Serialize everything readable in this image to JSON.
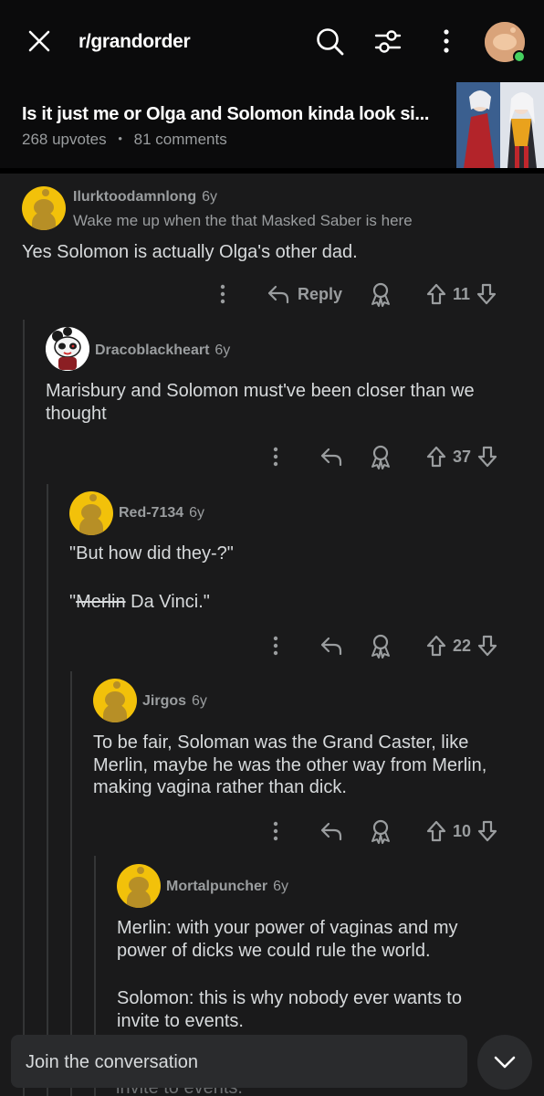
{
  "header": {
    "subreddit": "r/grandorder",
    "icons": [
      "close-icon",
      "search-icon",
      "filter-icon",
      "more-vertical-icon"
    ]
  },
  "post": {
    "title": "Is it just me or Olga and Solomon kinda look si...",
    "upvotes": "268 upvotes",
    "separator": "•",
    "comments": "81 comments"
  },
  "comments": [
    {
      "user": "Ilurktoodamnlong",
      "age": "6y",
      "flair": "Wake me up when the that Masked Saber is here",
      "body": "Yes Solomon is actually Olga's other dad.",
      "reply_label": "Reply",
      "votes": "11"
    },
    {
      "user": "Dracoblackheart",
      "age": "6y",
      "body_line1": "Marisbury and Solomon must've been closer than we",
      "body_line2": "thought",
      "votes": "37"
    },
    {
      "user": "Red-7134",
      "age": "6y",
      "body_p1": "\"But how did they-?\"",
      "body_p2_open": "\"",
      "body_p2_strike": "Merlin",
      "body_p2_rest": " Da Vinci.\"",
      "votes": "22"
    },
    {
      "user": "Jirgos",
      "age": "6y",
      "body_line1": "To be fair, Soloman was the Grand Caster, like",
      "body_line2": "Merlin, maybe he was the other way from Merlin,",
      "body_line3": "making vagina rather than dick.",
      "votes": "10"
    },
    {
      "user": "Mortalpuncher",
      "age": "6y",
      "body_line1": "Merlin: with your power of vaginas and my",
      "body_line2": "power of dicks we could rule the world.",
      "body_line3": "Solomon: this is why nobody ever wants to",
      "body_line4": "invite to events."
    }
  ],
  "bottom": {
    "join_placeholder": "Join the conversation",
    "peek": "invite to events."
  },
  "colors": {
    "background": "#1a1a1b",
    "topbar": "#0b0b0c",
    "avatar_yellow": "#f2c10a",
    "online": "#46d160",
    "meta_text": "#9a9d9f"
  }
}
